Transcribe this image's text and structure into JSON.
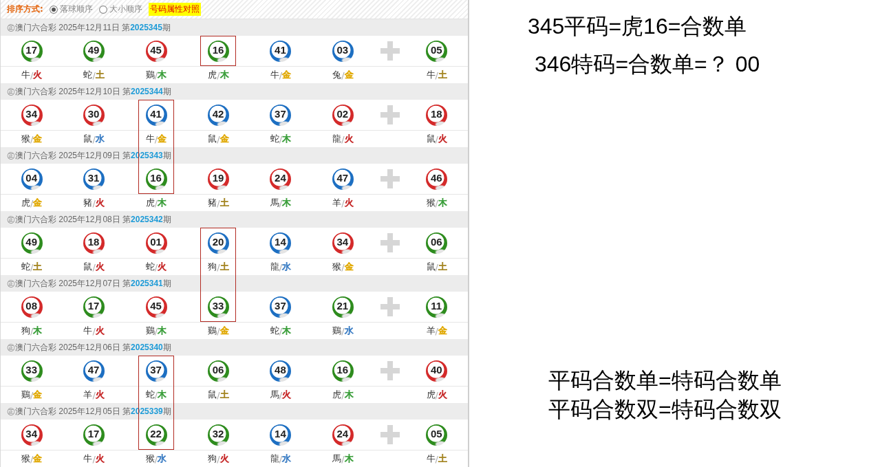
{
  "sort_bar": {
    "label": "排序方式:",
    "options": [
      {
        "label": "落球顺序",
        "selected": true
      },
      {
        "label": "大小顺序",
        "selected": false
      }
    ],
    "attribute_link": "号码属性对照"
  },
  "draws": [
    {
      "title": "㊣澳门六合彩 2025年12月11日 第**2025345**期",
      "balls": [
        {
          "number": "17",
          "color": "#2e8c1e",
          "zodiac": "牛",
          "separator": "/",
          "element": {
            "name": "火",
            "color": "#c62828"
          },
          "marked": false
        },
        {
          "number": "49",
          "color": "#2e8c1e",
          "zodiac": "蛇",
          "separator": "/",
          "element": {
            "name": "土",
            "color": "#a38420"
          },
          "marked": false
        },
        {
          "number": "45",
          "color": "#d42a2a",
          "zodiac": "鷄",
          "separator": "/",
          "element": {
            "name": "木",
            "color": "#3a9e3a"
          },
          "marked": false
        },
        {
          "number": "16",
          "color": "#2e8c1e",
          "zodiac": "虎",
          "separator": "/",
          "element": {
            "name": "木",
            "color": "#3a9e3a"
          },
          "marked": true
        },
        {
          "number": "41",
          "color": "#1d6fc2",
          "zodiac": "牛",
          "separator": "/",
          "element": {
            "name": "金",
            "color": "#e0a800"
          },
          "marked": false
        },
        {
          "number": "03",
          "color": "#1d6fc2",
          "zodiac": "兔",
          "separator": "/",
          "element": {
            "name": "金",
            "color": "#e0a800"
          },
          "marked": false
        }
      ],
      "special": {
        "number": "05",
        "color": "#2e8c1e",
        "zodiac": "牛",
        "separator": "/",
        "element": {
          "name": "土",
          "color": "#a38420"
        },
        "marked": false
      }
    },
    {
      "title": "㊣澳门六合彩 2025年12月10日 第**2025344**期",
      "balls": [
        {
          "number": "34",
          "color": "#d42a2a",
          "zodiac": "猴",
          "separator": "/",
          "element": {
            "name": "金",
            "color": "#e0a800"
          },
          "marked": false
        },
        {
          "number": "30",
          "color": "#d42a2a",
          "zodiac": "鼠",
          "separator": "/",
          "element": {
            "name": "水",
            "color": "#3b7dc4"
          },
          "marked": false
        },
        {
          "number": "41",
          "color": "#1d6fc2",
          "zodiac": "牛",
          "separator": "/",
          "element": {
            "name": "金",
            "color": "#e0a800"
          },
          "marked": true
        },
        {
          "number": "42",
          "color": "#1d6fc2",
          "zodiac": "鼠",
          "separator": "/",
          "element": {
            "name": "金",
            "color": "#e0a800"
          },
          "marked": false
        },
        {
          "number": "37",
          "color": "#1d6fc2",
          "zodiac": "蛇",
          "separator": "/",
          "element": {
            "name": "木",
            "color": "#3a9e3a"
          },
          "marked": false
        },
        {
          "number": "02",
          "color": "#d42a2a",
          "zodiac": "龍",
          "separator": "/",
          "element": {
            "name": "火",
            "color": "#c62828"
          },
          "marked": false
        }
      ],
      "special": {
        "number": "18",
        "color": "#d42a2a",
        "zodiac": "鼠",
        "separator": "/",
        "element": {
          "name": "火",
          "color": "#c62828"
        },
        "marked": false
      }
    },
    {
      "title": "㊣澳门六合彩 2025年12月09日 第**2025343**期",
      "balls": [
        {
          "number": "04",
          "color": "#1d6fc2",
          "zodiac": "虎",
          "separator": "/",
          "element": {
            "name": "金",
            "color": "#e0a800"
          },
          "marked": false
        },
        {
          "number": "31",
          "color": "#1d6fc2",
          "zodiac": "豬",
          "separator": "/",
          "element": {
            "name": "火",
            "color": "#c62828"
          },
          "marked": false
        },
        {
          "number": "16",
          "color": "#2e8c1e",
          "zodiac": "虎",
          "separator": "/",
          "element": {
            "name": "木",
            "color": "#3a9e3a"
          },
          "marked": true
        },
        {
          "number": "19",
          "color": "#d42a2a",
          "zodiac": "豬",
          "separator": "/",
          "element": {
            "name": "土",
            "color": "#a38420"
          },
          "marked": false
        },
        {
          "number": "24",
          "color": "#d42a2a",
          "zodiac": "馬",
          "separator": "/",
          "element": {
            "name": "木",
            "color": "#3a9e3a"
          },
          "marked": false
        },
        {
          "number": "47",
          "color": "#1d6fc2",
          "zodiac": "羊",
          "separator": "/",
          "element": {
            "name": "火",
            "color": "#c62828"
          },
          "marked": false
        }
      ],
      "special": {
        "number": "46",
        "color": "#d42a2a",
        "zodiac": "猴",
        "separator": "/",
        "element": {
          "name": "木",
          "color": "#3a9e3a"
        },
        "marked": false
      }
    },
    {
      "title": "㊣澳门六合彩 2025年12月08日 第**2025342**期",
      "balls": [
        {
          "number": "49",
          "color": "#2e8c1e",
          "zodiac": "蛇",
          "separator": "/",
          "element": {
            "name": "土",
            "color": "#a38420"
          },
          "marked": false
        },
        {
          "number": "18",
          "color": "#d42a2a",
          "zodiac": "鼠",
          "separator": "/",
          "element": {
            "name": "火",
            "color": "#c62828"
          },
          "marked": false
        },
        {
          "number": "01",
          "color": "#d42a2a",
          "zodiac": "蛇",
          "separator": "/",
          "element": {
            "name": "火",
            "color": "#c62828"
          },
          "marked": false
        },
        {
          "number": "20",
          "color": "#1d6fc2",
          "zodiac": "狗",
          "separator": "/",
          "element": {
            "name": "土",
            "color": "#a38420"
          },
          "marked": true
        },
        {
          "number": "14",
          "color": "#1d6fc2",
          "zodiac": "龍",
          "separator": "/",
          "element": {
            "name": "水",
            "color": "#3b7dc4"
          },
          "marked": false
        },
        {
          "number": "34",
          "color": "#d42a2a",
          "zodiac": "猴",
          "separator": "/",
          "element": {
            "name": "金",
            "color": "#e0a800"
          },
          "marked": false
        }
      ],
      "special": {
        "number": "06",
        "color": "#2e8c1e",
        "zodiac": "鼠",
        "separator": "/",
        "element": {
          "name": "土",
          "color": "#a38420"
        },
        "marked": false
      }
    },
    {
      "title": "㊣澳门六合彩 2025年12月07日 第**2025341**期",
      "balls": [
        {
          "number": "08",
          "color": "#d42a2a",
          "zodiac": "狗",
          "separator": "/",
          "element": {
            "name": "木",
            "color": "#3a9e3a"
          },
          "marked": false
        },
        {
          "number": "17",
          "color": "#2e8c1e",
          "zodiac": "牛",
          "separator": "/",
          "element": {
            "name": "火",
            "color": "#c62828"
          },
          "marked": false
        },
        {
          "number": "45",
          "color": "#d42a2a",
          "zodiac": "鷄",
          "separator": "/",
          "element": {
            "name": "木",
            "color": "#3a9e3a"
          },
          "marked": false
        },
        {
          "number": "33",
          "color": "#2e8c1e",
          "zodiac": "鷄",
          "separator": "/",
          "element": {
            "name": "金",
            "color": "#e0a800"
          },
          "marked": true
        },
        {
          "number": "37",
          "color": "#1d6fc2",
          "zodiac": "蛇",
          "separator": "/",
          "element": {
            "name": "木",
            "color": "#3a9e3a"
          },
          "marked": false
        },
        {
          "number": "21",
          "color": "#2e8c1e",
          "zodiac": "鷄",
          "separator": "/",
          "element": {
            "name": "水",
            "color": "#3b7dc4"
          },
          "marked": false
        }
      ],
      "special": {
        "number": "11",
        "color": "#2e8c1e",
        "zodiac": "羊",
        "separator": "/",
        "element": {
          "name": "金",
          "color": "#e0a800"
        },
        "marked": false
      }
    },
    {
      "title": "㊣澳门六合彩 2025年12月06日 第**2025340**期",
      "balls": [
        {
          "number": "33",
          "color": "#2e8c1e",
          "zodiac": "鷄",
          "separator": "/",
          "element": {
            "name": "金",
            "color": "#e0a800"
          },
          "marked": false
        },
        {
          "number": "47",
          "color": "#1d6fc2",
          "zodiac": "羊",
          "separator": "/",
          "element": {
            "name": "火",
            "color": "#c62828"
          },
          "marked": false
        },
        {
          "number": "37",
          "color": "#1d6fc2",
          "zodiac": "蛇",
          "separator": "/",
          "element": {
            "name": "木",
            "color": "#3a9e3a"
          },
          "marked": true
        },
        {
          "number": "06",
          "color": "#2e8c1e",
          "zodiac": "鼠",
          "separator": "/",
          "element": {
            "name": "土",
            "color": "#a38420"
          },
          "marked": false
        },
        {
          "number": "48",
          "color": "#1d6fc2",
          "zodiac": "馬",
          "separator": "/",
          "element": {
            "name": "火",
            "color": "#c62828"
          },
          "marked": false
        },
        {
          "number": "16",
          "color": "#2e8c1e",
          "zodiac": "虎",
          "separator": "/",
          "element": {
            "name": "木",
            "color": "#3a9e3a"
          },
          "marked": false
        }
      ],
      "special": {
        "number": "40",
        "color": "#d42a2a",
        "zodiac": "虎",
        "separator": "/",
        "element": {
          "name": "火",
          "color": "#c62828"
        },
        "marked": false
      }
    },
    {
      "title": "㊣澳门六合彩 2025年12月05日 第**2025339**期",
      "balls": [
        {
          "number": "34",
          "color": "#d42a2a",
          "zodiac": "猴",
          "separator": "/",
          "element": {
            "name": "金",
            "color": "#e0a800"
          },
          "marked": false
        },
        {
          "number": "17",
          "color": "#2e8c1e",
          "zodiac": "牛",
          "separator": "/",
          "element": {
            "name": "火",
            "color": "#c62828"
          },
          "marked": false
        },
        {
          "number": "22",
          "color": "#2e8c1e",
          "zodiac": "猴",
          "separator": "/",
          "element": {
            "name": "水",
            "color": "#3b7dc4"
          },
          "marked": true
        },
        {
          "number": "32",
          "color": "#2e8c1e",
          "zodiac": "狗",
          "separator": "/",
          "element": {
            "name": "火",
            "color": "#c62828"
          },
          "marked": false
        },
        {
          "number": "14",
          "color": "#1d6fc2",
          "zodiac": "龍",
          "separator": "/",
          "element": {
            "name": "水",
            "color": "#3b7dc4"
          },
          "marked": false
        },
        {
          "number": "24",
          "color": "#d42a2a",
          "zodiac": "馬",
          "separator": "/",
          "element": {
            "name": "木",
            "color": "#3a9e3a"
          },
          "marked": false
        }
      ],
      "special": {
        "number": "05",
        "color": "#2e8c1e",
        "zodiac": "牛",
        "separator": "/",
        "element": {
          "name": "土",
          "color": "#a38420"
        },
        "marked": false
      }
    }
  ],
  "notes_top": [
    "345平码=虎16=合数单",
    "346特码=合数单=？ 00"
  ],
  "notes_bottom": [
    "平码合数单=特码合数单",
    "平码合数双=特码合数双"
  ]
}
